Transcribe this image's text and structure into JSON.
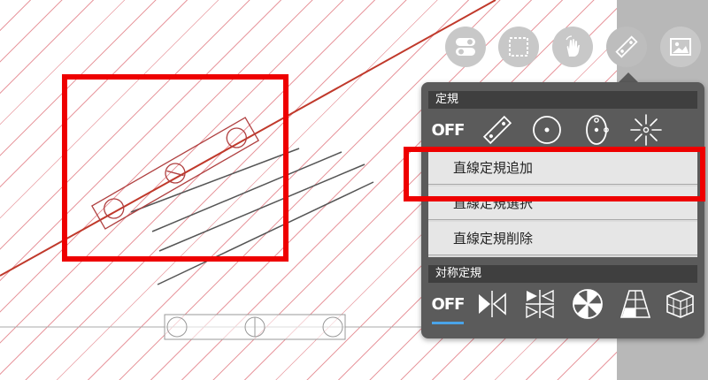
{
  "toolbar": {
    "buttons": [
      {
        "name": "toggle-switch-icon",
        "active": false
      },
      {
        "name": "selection-icon",
        "active": false
      },
      {
        "name": "hand-icon",
        "active": false
      },
      {
        "name": "ruler-icon",
        "active": true
      },
      {
        "name": "image-icon",
        "active": false
      }
    ]
  },
  "panel": {
    "ruler_section_title": "定規",
    "ruler_icons": [
      "off-icon",
      "linear-ruler-icon",
      "circle-ruler-icon",
      "ellipse-ruler-icon",
      "radial-ruler-icon"
    ],
    "off_label": "OFF",
    "menu_items": [
      "直線定規追加",
      "直線定規選択",
      "直線定規削除"
    ],
    "symmetry_section_title": "対称定規",
    "symmetry_off_label": "OFF",
    "symmetry_icons": [
      "symmetry-off-icon",
      "line-symmetry-icon",
      "quad-symmetry-icon",
      "radial-symmetry-icon",
      "perspective-1pt-icon",
      "perspective-3d-icon"
    ]
  },
  "colors": {
    "highlight": "#ee0000",
    "ruler_line": "#c0392b",
    "panel": "#5b5b5b",
    "selected_underline": "#4aa3e8"
  }
}
